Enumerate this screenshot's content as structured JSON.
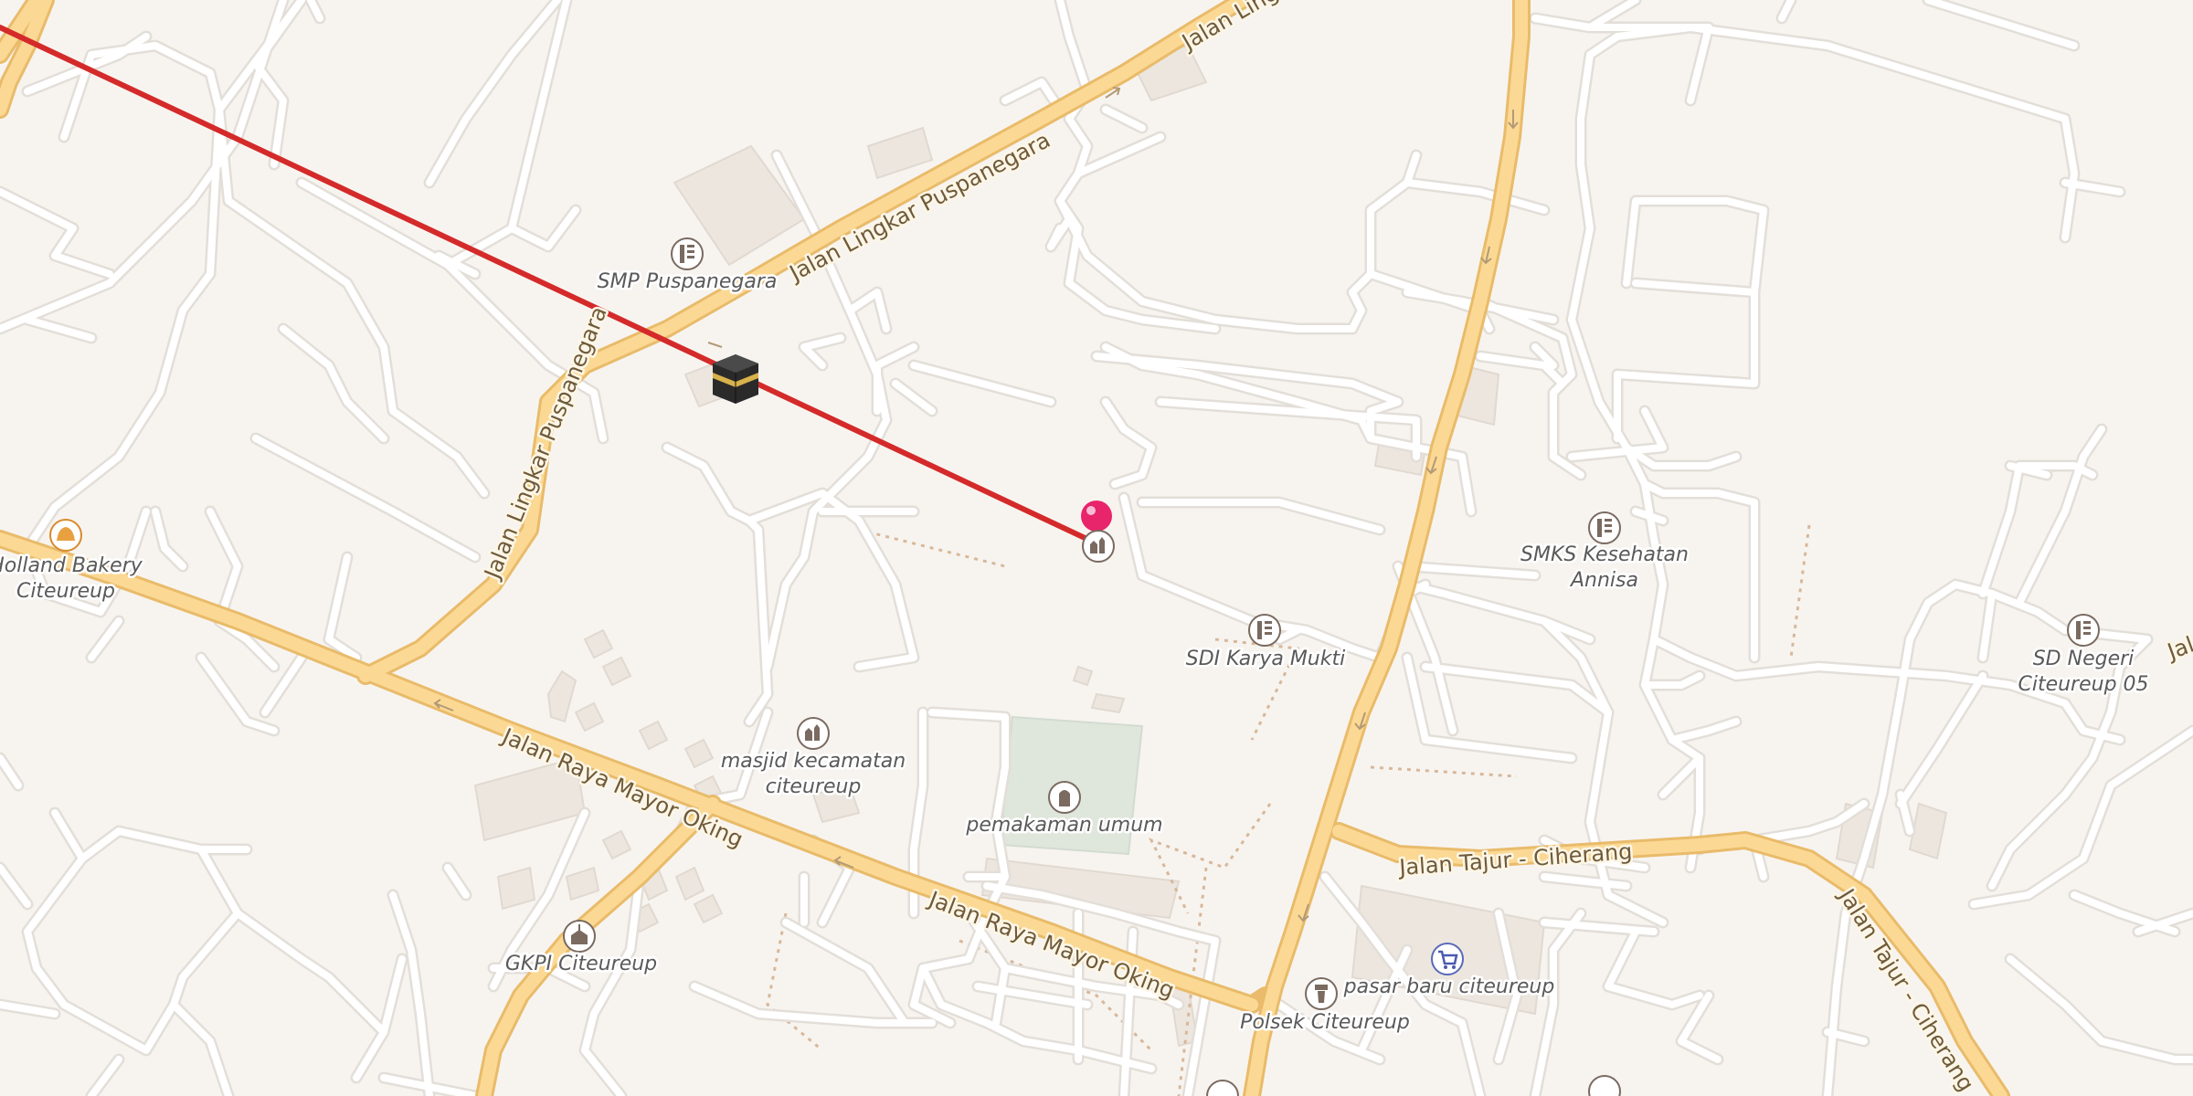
{
  "colors": {
    "background": "#f7f4f0",
    "minor_road": "#ffffff",
    "minor_road_casing": "#e3ded8",
    "major_road": "#fbd994",
    "major_road_casing": "#e9bb6a",
    "building": "#ece6df",
    "cemetery": "#dfe6dc",
    "path": "#d8b89a",
    "qibla_line": "#d42a2a",
    "pin": "#e8246a",
    "poi_icon": "#7a6a60"
  },
  "markers": {
    "location_pin": "location-pin-icon",
    "kaaba": "kaaba-icon"
  },
  "road_labels": {
    "lingkar_top": "Jalan Lingkar",
    "lingkar_mid": "Jalan Lingkar Puspanegara",
    "lingkar_low": "Jalan Lingkar Puspanegara",
    "mayor_oking_west": "Jalan Raya Mayor Oking",
    "mayor_oking_east": "Jalan Raya Mayor Oking",
    "tajur_1": "Jalan Tajur - Ciherang",
    "tajur_2": "Jalan Tajur - Ciherang",
    "edge_fragment": "Jal"
  },
  "pois": {
    "smp": {
      "name": "SMP Puspanegara",
      "icon": "school-icon"
    },
    "holland": {
      "name1": "Holland Bakery",
      "name2": "Citeureup",
      "icon": "bakery-icon"
    },
    "smks": {
      "name1": "SMKS Kesehatan",
      "name2": "Annisa",
      "icon": "school-icon"
    },
    "sdi": {
      "name": "SDI Karya Mukti",
      "icon": "school-icon"
    },
    "sdn": {
      "name1": "SD Negeri",
      "name2": "Citeureup 05",
      "icon": "school-icon"
    },
    "masjid": {
      "name1": "masjid kecamatan",
      "name2": "citeureup",
      "icon": "mosque-icon"
    },
    "pemakaman": {
      "name": "pemakaman umum",
      "icon": "cemetery-icon"
    },
    "gkpi": {
      "name": "GKPI Citeureup",
      "icon": "church-icon"
    },
    "pasar": {
      "name": "pasar baru citeureup",
      "icon": "shopping-cart-icon"
    },
    "polsek": {
      "name": "Polsek Citeureup",
      "icon": "police-icon"
    },
    "pin_poi": {
      "icon": "mosque-icon"
    }
  }
}
